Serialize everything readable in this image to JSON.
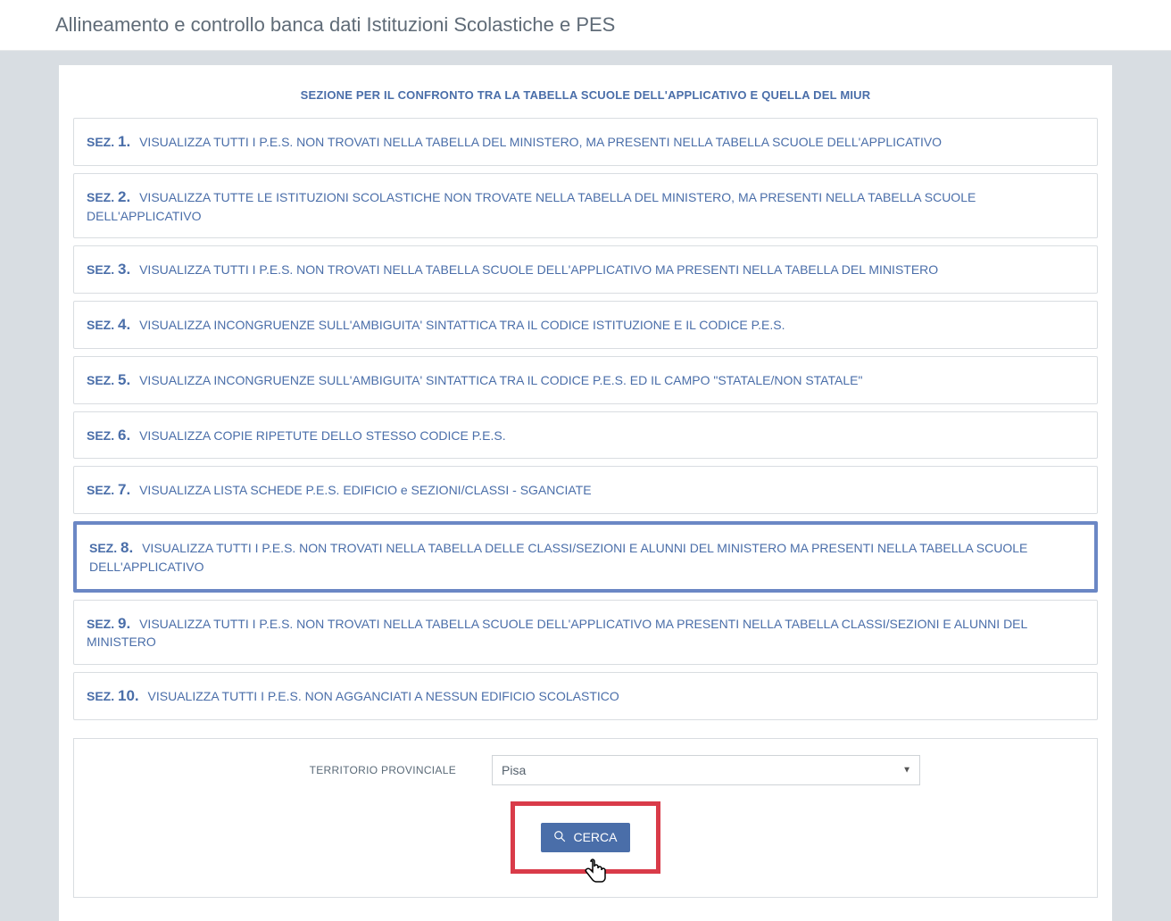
{
  "page": {
    "title": "Allineamento e controllo banca dati Istituzioni Scolastiche e PES"
  },
  "header": {
    "section_heading": "SEZIONE PER IL CONFRONTO TRA LA TABELLA SCUOLE DELL'APPLICATIVO E QUELLA DEL MIUR"
  },
  "sections": [
    {
      "prefix": "SEZ. ",
      "num": "1.",
      "desc": "VISUALIZZA TUTTI I P.E.S. NON TROVATI NELLA TABELLA DEL MINISTERO, MA PRESENTI NELLA TABELLA SCUOLE DELL'APPLICATIVO",
      "selected": false
    },
    {
      "prefix": "SEZ. ",
      "num": "2.",
      "desc": "VISUALIZZA TUTTE LE ISTITUZIONI SCOLASTICHE NON TROVATE NELLA TABELLA DEL MINISTERO, MA PRESENTI NELLA TABELLA SCUOLE DELL'APPLICATIVO",
      "selected": false
    },
    {
      "prefix": "SEZ. ",
      "num": "3.",
      "desc": "VISUALIZZA TUTTI I P.E.S. NON TROVATI NELLA TABELLA SCUOLE DELL'APPLICATIVO MA PRESENTI NELLA TABELLA DEL MINISTERO",
      "selected": false
    },
    {
      "prefix": "SEZ. ",
      "num": "4.",
      "desc": "VISUALIZZA INCONGRUENZE SULL'AMBIGUITA' SINTATTICA TRA IL CODICE ISTITUZIONE E IL CODICE P.E.S.",
      "selected": false
    },
    {
      "prefix": "SEZ. ",
      "num": "5.",
      "desc": "VISUALIZZA INCONGRUENZE SULL'AMBIGUITA' SINTATTICA TRA IL CODICE P.E.S. ED IL CAMPO \"STATALE/NON STATALE\"",
      "selected": false
    },
    {
      "prefix": "SEZ. ",
      "num": "6.",
      "desc": "VISUALIZZA COPIE RIPETUTE DELLO STESSO CODICE P.E.S.",
      "selected": false
    },
    {
      "prefix": "SEZ. ",
      "num": "7.",
      "desc": "VISUALIZZA LISTA SCHEDE P.E.S. EDIFICIO e SEZIONI/CLASSI - SGANCIATE",
      "selected": false
    },
    {
      "prefix": "SEZ. ",
      "num": "8.",
      "desc": "VISUALIZZA TUTTI I P.E.S. NON TROVATI NELLA TABELLA DELLE CLASSI/SEZIONI E ALUNNI DEL MINISTERO MA PRESENTI NELLA TABELLA SCUOLE DELL'APPLICATIVO",
      "selected": true
    },
    {
      "prefix": "SEZ. ",
      "num": "9.",
      "desc": "VISUALIZZA TUTTI I P.E.S. NON TROVATI NELLA TABELLA SCUOLE DELL'APPLICATIVO MA PRESENTI NELLA TABELLA CLASSI/SEZIONI E ALUNNI DEL MINISTERO",
      "selected": false
    },
    {
      "prefix": "SEZ. ",
      "num": "10.",
      "desc": "VISUALIZZA TUTTI I P.E.S. NON AGGANCIATI A NESSUN EDIFICIO SCOLASTICO",
      "selected": false
    }
  ],
  "filter": {
    "label": "TERRITORIO PROVINCIALE",
    "selected": "Pisa"
  },
  "actions": {
    "search_label": "CERCA"
  }
}
